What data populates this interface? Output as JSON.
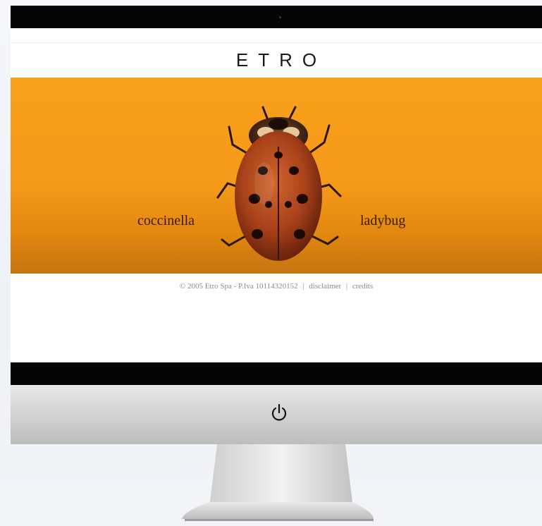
{
  "site": {
    "brand_logo": "ETRO",
    "banner": {
      "left_label": "coccinella",
      "right_label": "ladybug",
      "background_color": "#f59a17",
      "image_subject": "ladybug-illustration"
    },
    "footer": {
      "copyright": "© 2005 Etro Spa - P.Iva 10114320152",
      "separator": "|",
      "links": [
        "disclaimer",
        "credits"
      ]
    }
  },
  "device": {
    "type": "desktop-monitor",
    "power_button_icon": "power-icon"
  }
}
